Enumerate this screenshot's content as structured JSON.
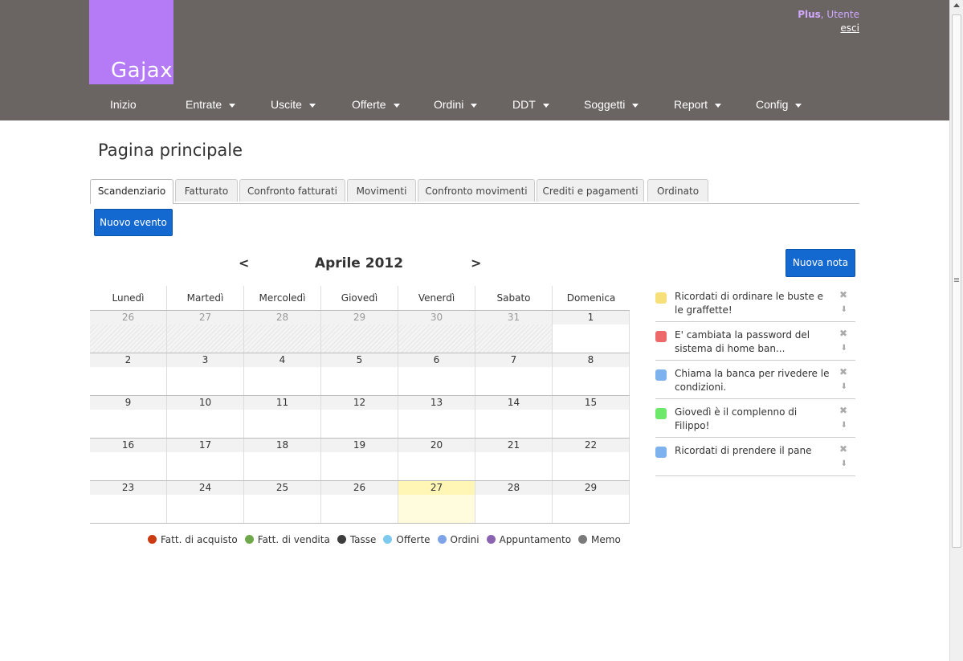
{
  "header": {
    "logo_text": "Gajax",
    "plan": "Plus",
    "separator": ", ",
    "username": "Utente",
    "logout": "esci",
    "nav": [
      {
        "label": "Inizio",
        "dropdown": false
      },
      {
        "label": "Entrate",
        "dropdown": true
      },
      {
        "label": "Uscite",
        "dropdown": true
      },
      {
        "label": "Offerte",
        "dropdown": true
      },
      {
        "label": "Ordini",
        "dropdown": true
      },
      {
        "label": "DDT",
        "dropdown": true
      },
      {
        "label": "Soggetti",
        "dropdown": true
      },
      {
        "label": "Report",
        "dropdown": true
      },
      {
        "label": "Config",
        "dropdown": true
      }
    ]
  },
  "page": {
    "title": "Pagina principale",
    "tabs": [
      {
        "label": "Scandenziario",
        "active": true
      },
      {
        "label": "Fatturato",
        "active": false
      },
      {
        "label": "Confronto fatturati",
        "active": false
      },
      {
        "label": "Movimenti",
        "active": false
      },
      {
        "label": "Confronto movimenti",
        "active": false
      },
      {
        "label": "Crediti e pagamenti",
        "active": false
      },
      {
        "label": "Ordinato",
        "active": false
      }
    ],
    "new_event_button": "Nuovo evento",
    "new_note_button": "Nuova nota"
  },
  "calendar": {
    "prev": "<",
    "next": ">",
    "month_title": "Aprile 2012",
    "weekdays": [
      "Lunedì",
      "Martedì",
      "Mercoledì",
      "Giovedì",
      "Venerdì",
      "Sabato",
      "Domenica"
    ],
    "weeks": [
      [
        {
          "d": "26",
          "other": true
        },
        {
          "d": "27",
          "other": true
        },
        {
          "d": "28",
          "other": true
        },
        {
          "d": "29",
          "other": true
        },
        {
          "d": "30",
          "other": true
        },
        {
          "d": "31",
          "other": true
        },
        {
          "d": "1",
          "other": false
        }
      ],
      [
        {
          "d": "2"
        },
        {
          "d": "3"
        },
        {
          "d": "4"
        },
        {
          "d": "5"
        },
        {
          "d": "6"
        },
        {
          "d": "7"
        },
        {
          "d": "8"
        }
      ],
      [
        {
          "d": "9"
        },
        {
          "d": "10"
        },
        {
          "d": "11"
        },
        {
          "d": "12"
        },
        {
          "d": "13"
        },
        {
          "d": "14"
        },
        {
          "d": "15"
        }
      ],
      [
        {
          "d": "16"
        },
        {
          "d": "17"
        },
        {
          "d": "18"
        },
        {
          "d": "19"
        },
        {
          "d": "20"
        },
        {
          "d": "21"
        },
        {
          "d": "22"
        }
      ],
      [
        {
          "d": "23"
        },
        {
          "d": "24"
        },
        {
          "d": "25"
        },
        {
          "d": "26"
        },
        {
          "d": "27",
          "today": true
        },
        {
          "d": "28"
        },
        {
          "d": "29"
        }
      ]
    ],
    "legend": [
      {
        "label": "Fatt. di acquisto",
        "color": "#cc3a12"
      },
      {
        "label": "Fatt. di vendita",
        "color": "#6fa84a"
      },
      {
        "label": "Tasse",
        "color": "#3d3d3d"
      },
      {
        "label": "Offerte",
        "color": "#7ec9ee"
      },
      {
        "label": "Ordini",
        "color": "#7ea3e8"
      },
      {
        "label": "Appuntamento",
        "color": "#8a64b0"
      },
      {
        "label": "Memo",
        "color": "#7a7a7a"
      }
    ]
  },
  "notes": [
    {
      "text": "Ricordati di ordinare le buste e le graffette!",
      "color": "#f7e07a"
    },
    {
      "text": "E' cambiata la password del sistema di home ban...",
      "color": "#ee6a6a"
    },
    {
      "text": "Chiama la banca per rivedere le condizioni.",
      "color": "#7eb2ee"
    },
    {
      "text": "Giovedì è il complenno di Filippo!",
      "color": "#6ee86a"
    },
    {
      "text": "Ricordati di prendere il pane",
      "color": "#7eb2ee"
    }
  ],
  "icons": {
    "delete": "✖",
    "move_down": "⬇"
  }
}
